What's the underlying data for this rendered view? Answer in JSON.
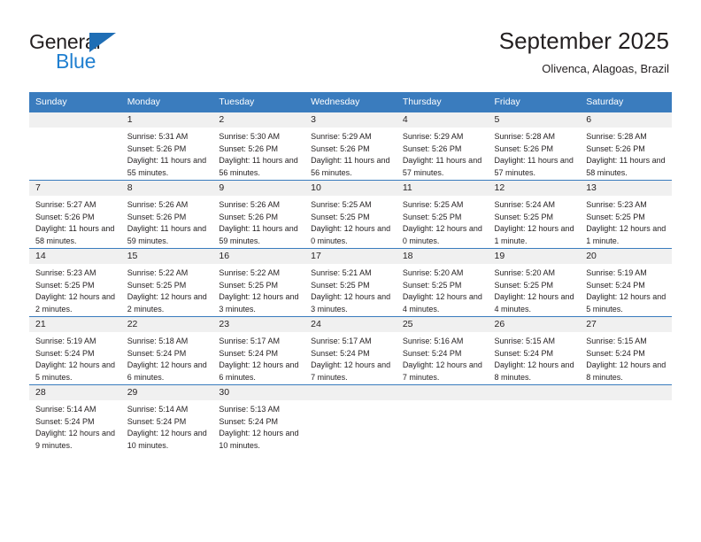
{
  "brand": {
    "name_part1": "General",
    "name_part2": "Blue",
    "triangle_icon": "triangle-icon",
    "accent_dark": "#231f20",
    "accent_blue": "#1f7fd0",
    "header_blue": "#3a7cbe"
  },
  "header": {
    "title": "September 2025",
    "subtitle": "Olivenca, Alagoas, Brazil"
  },
  "calendar": {
    "weekday_headers": [
      "Sunday",
      "Monday",
      "Tuesday",
      "Wednesday",
      "Thursday",
      "Friday",
      "Saturday"
    ],
    "weeks": [
      [
        {
          "day": "",
          "empty": true
        },
        {
          "day": "1",
          "sunrise": "Sunrise: 5:31 AM",
          "sunset": "Sunset: 5:26 PM",
          "daylight": "Daylight: 11 hours and 55 minutes."
        },
        {
          "day": "2",
          "sunrise": "Sunrise: 5:30 AM",
          "sunset": "Sunset: 5:26 PM",
          "daylight": "Daylight: 11 hours and 56 minutes."
        },
        {
          "day": "3",
          "sunrise": "Sunrise: 5:29 AM",
          "sunset": "Sunset: 5:26 PM",
          "daylight": "Daylight: 11 hours and 56 minutes."
        },
        {
          "day": "4",
          "sunrise": "Sunrise: 5:29 AM",
          "sunset": "Sunset: 5:26 PM",
          "daylight": "Daylight: 11 hours and 57 minutes."
        },
        {
          "day": "5",
          "sunrise": "Sunrise: 5:28 AM",
          "sunset": "Sunset: 5:26 PM",
          "daylight": "Daylight: 11 hours and 57 minutes."
        },
        {
          "day": "6",
          "sunrise": "Sunrise: 5:28 AM",
          "sunset": "Sunset: 5:26 PM",
          "daylight": "Daylight: 11 hours and 58 minutes."
        }
      ],
      [
        {
          "day": "7",
          "sunrise": "Sunrise: 5:27 AM",
          "sunset": "Sunset: 5:26 PM",
          "daylight": "Daylight: 11 hours and 58 minutes."
        },
        {
          "day": "8",
          "sunrise": "Sunrise: 5:26 AM",
          "sunset": "Sunset: 5:26 PM",
          "daylight": "Daylight: 11 hours and 59 minutes."
        },
        {
          "day": "9",
          "sunrise": "Sunrise: 5:26 AM",
          "sunset": "Sunset: 5:26 PM",
          "daylight": "Daylight: 11 hours and 59 minutes."
        },
        {
          "day": "10",
          "sunrise": "Sunrise: 5:25 AM",
          "sunset": "Sunset: 5:25 PM",
          "daylight": "Daylight: 12 hours and 0 minutes."
        },
        {
          "day": "11",
          "sunrise": "Sunrise: 5:25 AM",
          "sunset": "Sunset: 5:25 PM",
          "daylight": "Daylight: 12 hours and 0 minutes."
        },
        {
          "day": "12",
          "sunrise": "Sunrise: 5:24 AM",
          "sunset": "Sunset: 5:25 PM",
          "daylight": "Daylight: 12 hours and 1 minute."
        },
        {
          "day": "13",
          "sunrise": "Sunrise: 5:23 AM",
          "sunset": "Sunset: 5:25 PM",
          "daylight": "Daylight: 12 hours and 1 minute."
        }
      ],
      [
        {
          "day": "14",
          "sunrise": "Sunrise: 5:23 AM",
          "sunset": "Sunset: 5:25 PM",
          "daylight": "Daylight: 12 hours and 2 minutes."
        },
        {
          "day": "15",
          "sunrise": "Sunrise: 5:22 AM",
          "sunset": "Sunset: 5:25 PM",
          "daylight": "Daylight: 12 hours and 2 minutes."
        },
        {
          "day": "16",
          "sunrise": "Sunrise: 5:22 AM",
          "sunset": "Sunset: 5:25 PM",
          "daylight": "Daylight: 12 hours and 3 minutes."
        },
        {
          "day": "17",
          "sunrise": "Sunrise: 5:21 AM",
          "sunset": "Sunset: 5:25 PM",
          "daylight": "Daylight: 12 hours and 3 minutes."
        },
        {
          "day": "18",
          "sunrise": "Sunrise: 5:20 AM",
          "sunset": "Sunset: 5:25 PM",
          "daylight": "Daylight: 12 hours and 4 minutes."
        },
        {
          "day": "19",
          "sunrise": "Sunrise: 5:20 AM",
          "sunset": "Sunset: 5:25 PM",
          "daylight": "Daylight: 12 hours and 4 minutes."
        },
        {
          "day": "20",
          "sunrise": "Sunrise: 5:19 AM",
          "sunset": "Sunset: 5:24 PM",
          "daylight": "Daylight: 12 hours and 5 minutes."
        }
      ],
      [
        {
          "day": "21",
          "sunrise": "Sunrise: 5:19 AM",
          "sunset": "Sunset: 5:24 PM",
          "daylight": "Daylight: 12 hours and 5 minutes."
        },
        {
          "day": "22",
          "sunrise": "Sunrise: 5:18 AM",
          "sunset": "Sunset: 5:24 PM",
          "daylight": "Daylight: 12 hours and 6 minutes."
        },
        {
          "day": "23",
          "sunrise": "Sunrise: 5:17 AM",
          "sunset": "Sunset: 5:24 PM",
          "daylight": "Daylight: 12 hours and 6 minutes."
        },
        {
          "day": "24",
          "sunrise": "Sunrise: 5:17 AM",
          "sunset": "Sunset: 5:24 PM",
          "daylight": "Daylight: 12 hours and 7 minutes."
        },
        {
          "day": "25",
          "sunrise": "Sunrise: 5:16 AM",
          "sunset": "Sunset: 5:24 PM",
          "daylight": "Daylight: 12 hours and 7 minutes."
        },
        {
          "day": "26",
          "sunrise": "Sunrise: 5:15 AM",
          "sunset": "Sunset: 5:24 PM",
          "daylight": "Daylight: 12 hours and 8 minutes."
        },
        {
          "day": "27",
          "sunrise": "Sunrise: 5:15 AM",
          "sunset": "Sunset: 5:24 PM",
          "daylight": "Daylight: 12 hours and 8 minutes."
        }
      ],
      [
        {
          "day": "28",
          "sunrise": "Sunrise: 5:14 AM",
          "sunset": "Sunset: 5:24 PM",
          "daylight": "Daylight: 12 hours and 9 minutes."
        },
        {
          "day": "29",
          "sunrise": "Sunrise: 5:14 AM",
          "sunset": "Sunset: 5:24 PM",
          "daylight": "Daylight: 12 hours and 10 minutes."
        },
        {
          "day": "30",
          "sunrise": "Sunrise: 5:13 AM",
          "sunset": "Sunset: 5:24 PM",
          "daylight": "Daylight: 12 hours and 10 minutes."
        },
        {
          "day": "",
          "empty": true
        },
        {
          "day": "",
          "empty": true
        },
        {
          "day": "",
          "empty": true
        },
        {
          "day": "",
          "empty": true
        }
      ]
    ]
  }
}
